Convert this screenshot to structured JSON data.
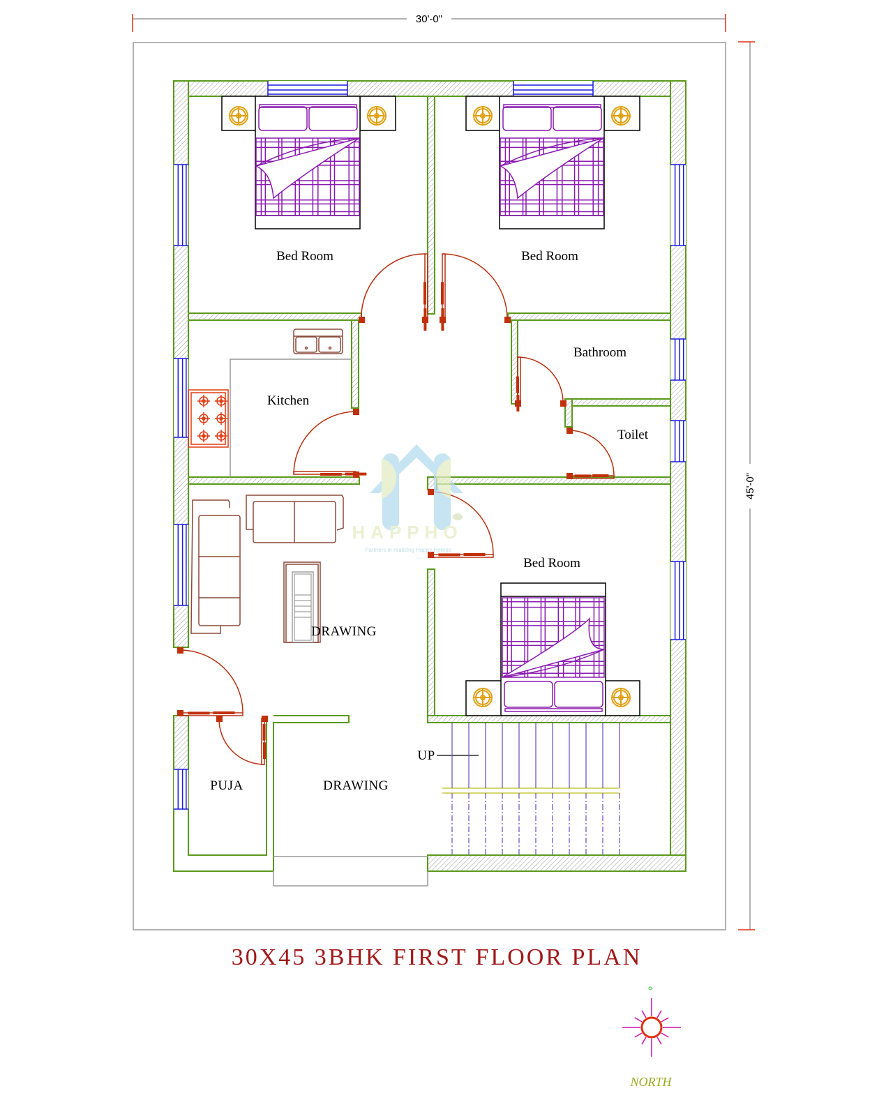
{
  "dimensions": {
    "width_label": "30'-0\"",
    "depth_label": "45'-0\""
  },
  "rooms": {
    "bedroom_top_left": "Bed Room",
    "bedroom_top_right": "Bed Room",
    "kitchen": "Kitchen",
    "bathroom": "Bathroom",
    "toilet": "Toilet",
    "bedroom_lower_right": "Bed Room",
    "drawing_upper": "DRAWING",
    "puja": "PUJA",
    "drawing_lower": "DRAWING",
    "stair_up": "UP"
  },
  "watermark": {
    "brand": "HAPPHO",
    "tagline": "Partners in realizing Happy Homes"
  },
  "title": "30X45 3BHK FIRST FLOOR PLAN",
  "compass": {
    "label": "NORTH"
  },
  "colors": {
    "wall_outline": "#5a9a1a",
    "window": "#1a1ae0",
    "door": "#b83010",
    "bed": "#8a1ab0",
    "lamp": "#e0a010",
    "title": "#a01818"
  }
}
